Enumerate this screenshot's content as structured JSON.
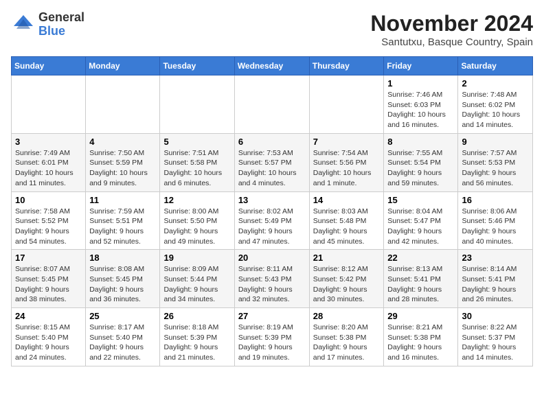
{
  "logo": {
    "general": "General",
    "blue": "Blue"
  },
  "title": "November 2024",
  "location": "Santutxu, Basque Country, Spain",
  "days_of_week": [
    "Sunday",
    "Monday",
    "Tuesday",
    "Wednesday",
    "Thursday",
    "Friday",
    "Saturday"
  ],
  "weeks": [
    [
      {
        "day": "",
        "info": ""
      },
      {
        "day": "",
        "info": ""
      },
      {
        "day": "",
        "info": ""
      },
      {
        "day": "",
        "info": ""
      },
      {
        "day": "",
        "info": ""
      },
      {
        "day": "1",
        "info": "Sunrise: 7:46 AM\nSunset: 6:03 PM\nDaylight: 10 hours and 16 minutes."
      },
      {
        "day": "2",
        "info": "Sunrise: 7:48 AM\nSunset: 6:02 PM\nDaylight: 10 hours and 14 minutes."
      }
    ],
    [
      {
        "day": "3",
        "info": "Sunrise: 7:49 AM\nSunset: 6:01 PM\nDaylight: 10 hours and 11 minutes."
      },
      {
        "day": "4",
        "info": "Sunrise: 7:50 AM\nSunset: 5:59 PM\nDaylight: 10 hours and 9 minutes."
      },
      {
        "day": "5",
        "info": "Sunrise: 7:51 AM\nSunset: 5:58 PM\nDaylight: 10 hours and 6 minutes."
      },
      {
        "day": "6",
        "info": "Sunrise: 7:53 AM\nSunset: 5:57 PM\nDaylight: 10 hours and 4 minutes."
      },
      {
        "day": "7",
        "info": "Sunrise: 7:54 AM\nSunset: 5:56 PM\nDaylight: 10 hours and 1 minute."
      },
      {
        "day": "8",
        "info": "Sunrise: 7:55 AM\nSunset: 5:54 PM\nDaylight: 9 hours and 59 minutes."
      },
      {
        "day": "9",
        "info": "Sunrise: 7:57 AM\nSunset: 5:53 PM\nDaylight: 9 hours and 56 minutes."
      }
    ],
    [
      {
        "day": "10",
        "info": "Sunrise: 7:58 AM\nSunset: 5:52 PM\nDaylight: 9 hours and 54 minutes."
      },
      {
        "day": "11",
        "info": "Sunrise: 7:59 AM\nSunset: 5:51 PM\nDaylight: 9 hours and 52 minutes."
      },
      {
        "day": "12",
        "info": "Sunrise: 8:00 AM\nSunset: 5:50 PM\nDaylight: 9 hours and 49 minutes."
      },
      {
        "day": "13",
        "info": "Sunrise: 8:02 AM\nSunset: 5:49 PM\nDaylight: 9 hours and 47 minutes."
      },
      {
        "day": "14",
        "info": "Sunrise: 8:03 AM\nSunset: 5:48 PM\nDaylight: 9 hours and 45 minutes."
      },
      {
        "day": "15",
        "info": "Sunrise: 8:04 AM\nSunset: 5:47 PM\nDaylight: 9 hours and 42 minutes."
      },
      {
        "day": "16",
        "info": "Sunrise: 8:06 AM\nSunset: 5:46 PM\nDaylight: 9 hours and 40 minutes."
      }
    ],
    [
      {
        "day": "17",
        "info": "Sunrise: 8:07 AM\nSunset: 5:45 PM\nDaylight: 9 hours and 38 minutes."
      },
      {
        "day": "18",
        "info": "Sunrise: 8:08 AM\nSunset: 5:45 PM\nDaylight: 9 hours and 36 minutes."
      },
      {
        "day": "19",
        "info": "Sunrise: 8:09 AM\nSunset: 5:44 PM\nDaylight: 9 hours and 34 minutes."
      },
      {
        "day": "20",
        "info": "Sunrise: 8:11 AM\nSunset: 5:43 PM\nDaylight: 9 hours and 32 minutes."
      },
      {
        "day": "21",
        "info": "Sunrise: 8:12 AM\nSunset: 5:42 PM\nDaylight: 9 hours and 30 minutes."
      },
      {
        "day": "22",
        "info": "Sunrise: 8:13 AM\nSunset: 5:41 PM\nDaylight: 9 hours and 28 minutes."
      },
      {
        "day": "23",
        "info": "Sunrise: 8:14 AM\nSunset: 5:41 PM\nDaylight: 9 hours and 26 minutes."
      }
    ],
    [
      {
        "day": "24",
        "info": "Sunrise: 8:15 AM\nSunset: 5:40 PM\nDaylight: 9 hours and 24 minutes."
      },
      {
        "day": "25",
        "info": "Sunrise: 8:17 AM\nSunset: 5:40 PM\nDaylight: 9 hours and 22 minutes."
      },
      {
        "day": "26",
        "info": "Sunrise: 8:18 AM\nSunset: 5:39 PM\nDaylight: 9 hours and 21 minutes."
      },
      {
        "day": "27",
        "info": "Sunrise: 8:19 AM\nSunset: 5:39 PM\nDaylight: 9 hours and 19 minutes."
      },
      {
        "day": "28",
        "info": "Sunrise: 8:20 AM\nSunset: 5:38 PM\nDaylight: 9 hours and 17 minutes."
      },
      {
        "day": "29",
        "info": "Sunrise: 8:21 AM\nSunset: 5:38 PM\nDaylight: 9 hours and 16 minutes."
      },
      {
        "day": "30",
        "info": "Sunrise: 8:22 AM\nSunset: 5:37 PM\nDaylight: 9 hours and 14 minutes."
      }
    ]
  ]
}
